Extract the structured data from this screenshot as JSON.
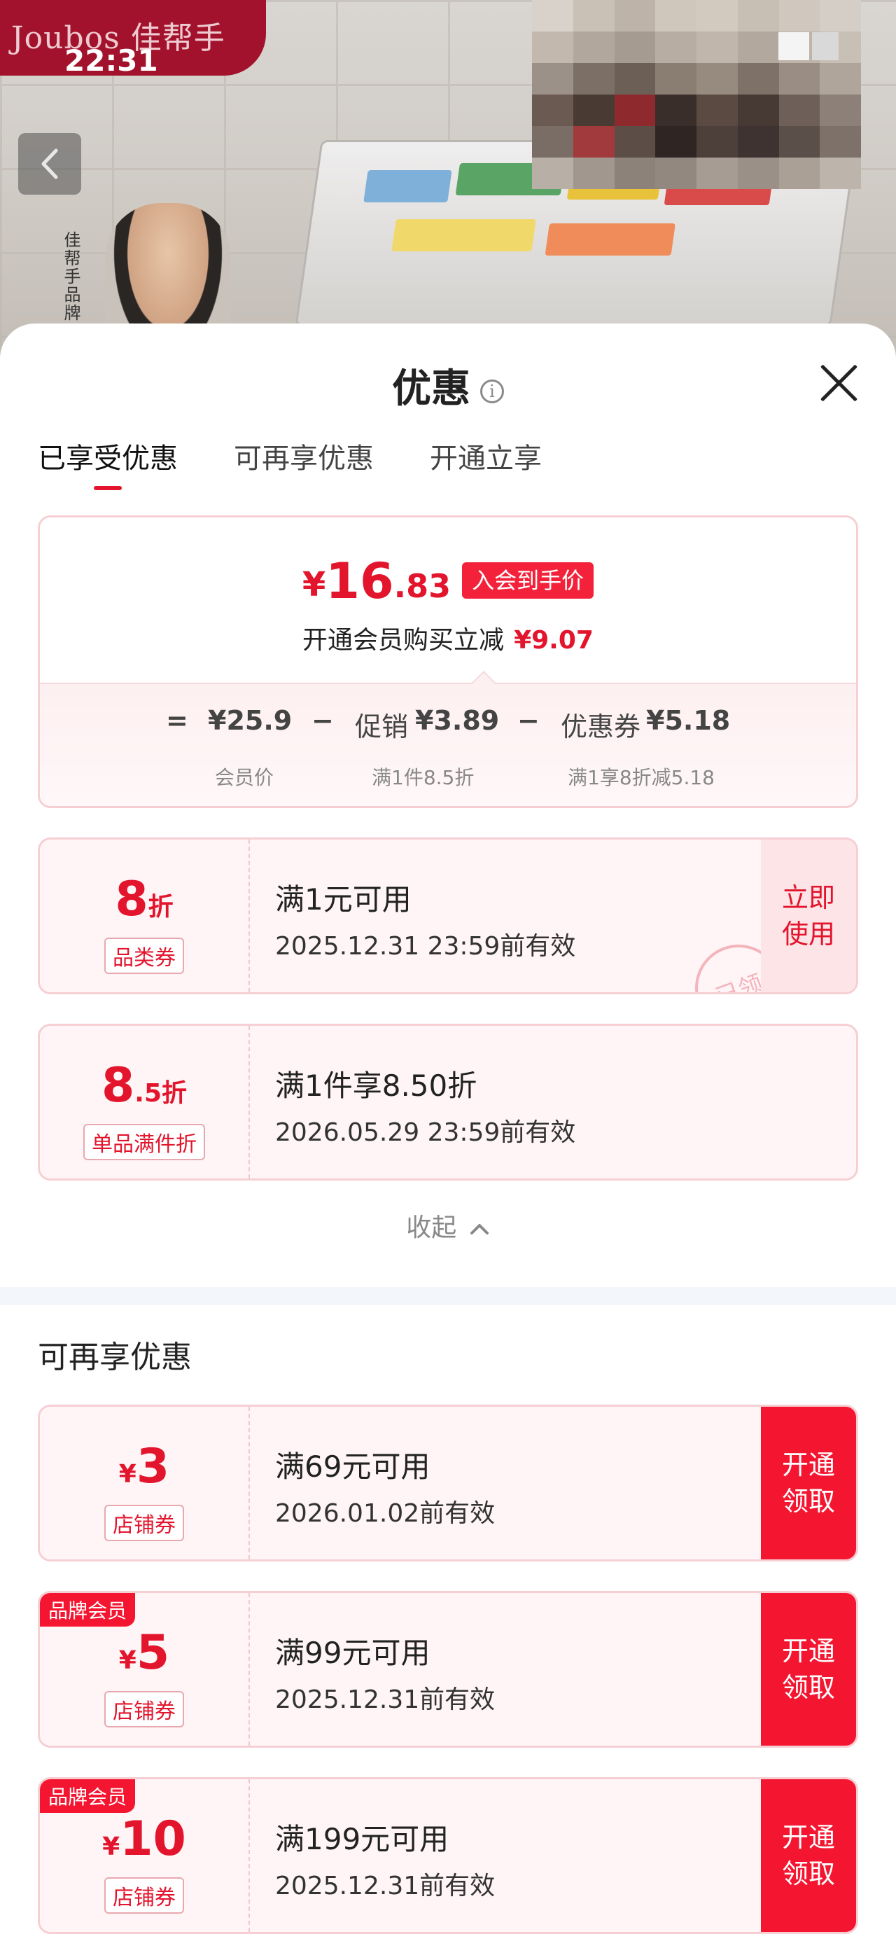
{
  "status_bar": {
    "time": "22:31",
    "brand": "Joubos 佳帮手"
  },
  "background": {
    "vertical_caption": "佳帮手品牌"
  },
  "sheet": {
    "title": "优惠",
    "info_icon": "i",
    "tabs": [
      {
        "label": "已享受优惠",
        "active": true
      },
      {
        "label": "可再享优惠",
        "active": false
      },
      {
        "label": "开通立享",
        "active": false
      }
    ]
  },
  "price_summary": {
    "currency": "¥",
    "price_int": "16",
    "price_dec": ".83",
    "tag": "入会到手价",
    "sub_text": "开通会员购买立减",
    "sub_amount": "¥9.07",
    "formula": {
      "equals": "=",
      "member_price": "¥25.9",
      "minus1": "−",
      "promo_label": "促销",
      "promo_amount": "¥3.89",
      "minus2": "−",
      "coupon_label": "优惠券",
      "coupon_amount": "¥5.18",
      "member_price_caption": "会员价",
      "promo_caption": "满1件8.5折",
      "coupon_caption": "满1享8折减5.18"
    }
  },
  "enjoyed_coupons": [
    {
      "value_big": "8",
      "value_unit": "折",
      "type": "品类券",
      "condition": "满1元可用",
      "expiry": "2025.12.31 23:59前有效",
      "action": "立即\n使用",
      "stamp": "已领"
    },
    {
      "value_big": "8",
      "value_mid": ".5",
      "value_unit": "折",
      "type": "单品满件折",
      "condition": "满1件享8.50折",
      "expiry": "2026.05.29 23:59前有效"
    }
  ],
  "collapse": {
    "label": "收起",
    "icon": "chevron-up-icon"
  },
  "more_section": {
    "title": "可再享优惠",
    "coupons": [
      {
        "badge": "",
        "currency": "¥",
        "value": "3",
        "type": "店铺券",
        "condition": "满69元可用",
        "expiry": "2026.01.02前有效",
        "action_line1": "开通",
        "action_line2": "领取"
      },
      {
        "badge": "品牌会员",
        "currency": "¥",
        "value": "5",
        "type": "店铺券",
        "condition": "满99元可用",
        "expiry": "2025.12.31前有效",
        "action_line1": "开通",
        "action_line2": "领取"
      },
      {
        "badge": "品牌会员",
        "currency": "¥",
        "value": "10",
        "type": "店铺券",
        "condition": "满199元可用",
        "expiry": "2025.12.31前有效",
        "action_line1": "开通",
        "action_line2": "领取"
      }
    ]
  },
  "colors": {
    "accent": "#e3152d",
    "button_red": "#f41631",
    "coupon_bg": "#fff5f6",
    "border": "#f6cfd4"
  }
}
